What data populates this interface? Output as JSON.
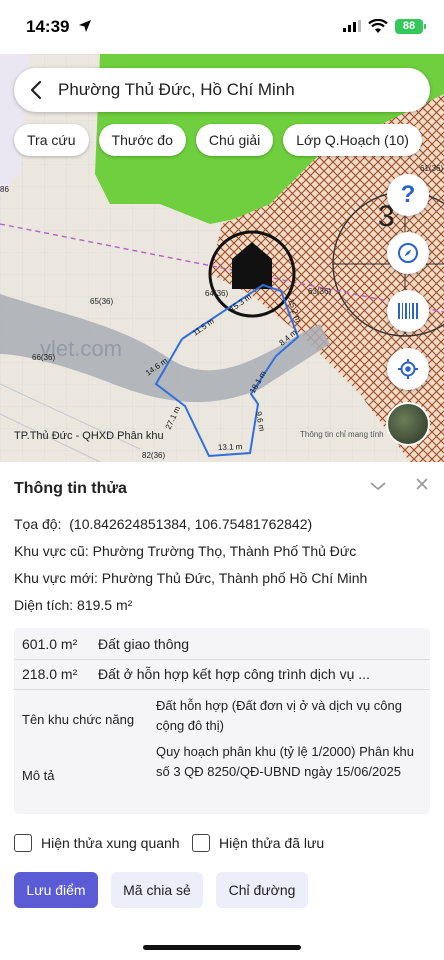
{
  "status_bar": {
    "time": "14:39",
    "battery": "88"
  },
  "map": {
    "search_title": "Phường Thủ Đức, Hồ Chí Minh",
    "chips": [
      "Tra cứu",
      "Thước đo",
      "Chú giải",
      "Lớp Q.Hoạch (10)"
    ],
    "fab_help_label": "?",
    "caption": "TP.Thủ Đức - QHXD Phân khu",
    "credit": "Thông tin chỉ mang tính",
    "parcel_labels": [
      "65(36)",
      "64(36)",
      "63(36)",
      "82(36)",
      "66(36)",
      "61(36)",
      "86"
    ],
    "edge_lengths": [
      "14.6 m",
      "11.5 m",
      "15.3 m",
      "15.2 m",
      "8.4 m",
      "18.1 m",
      "9.6 m",
      "13.1 m",
      "27.1 m"
    ],
    "watermark": "vlet.com",
    "zone_label": "3"
  },
  "info": {
    "title": "Thông tin thửa",
    "coords_label": "Tọa độ:",
    "coords_value": "(10.842624851384, 106.75481762842)",
    "old_area_label": "Khu vực cũ:",
    "old_area_value": "Phường Trường Thọ, Thành Phố Thủ Đức",
    "new_area_label": "Khu vực mới:",
    "new_area_value": "Phường Thủ Đức, Thành phố Hồ Chí Minh",
    "size_label": "Diện tích:",
    "size_value": "819.5 m²",
    "land_uses": [
      {
        "area": "601.0 m²",
        "type": "Đất giao thông"
      },
      {
        "area": "218.0 m²",
        "type": "Đất ở hỗn hợp kết hợp công trình dịch vụ ..."
      }
    ],
    "zone_function_label": "Tên khu chức năng",
    "zone_function_value": "Đất hỗn hợp (Đất đơn vị ở và dịch vụ công cộng đô thị)",
    "description_label": "Mô tả",
    "description_value": "Quy hoạch phân khu (tỷ lệ 1/2000) Phân khu số 3 QĐ 8250/QĐ-UBND ngày 15/06/2025",
    "checkbox_surrounding": "Hiện thửa xung quanh",
    "checkbox_saved": "Hiện thửa đã lưu",
    "btn_save": "Lưu điểm",
    "btn_share": "Mã chia sẻ",
    "btn_directions": "Chỉ đường"
  },
  "colors": {
    "accent": "#5b5bd6",
    "park_green": "#6fcf3e",
    "planning_hatch": "#a0522d",
    "parcel_outline": "#2f6fe0"
  }
}
